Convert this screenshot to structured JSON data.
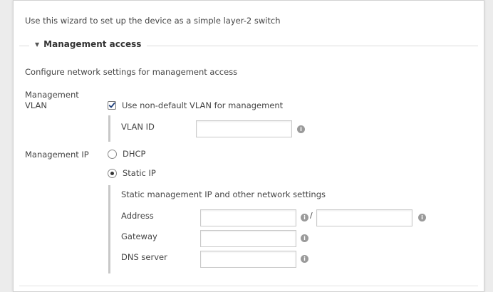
{
  "intro_text": "Use this wizard to set up the device as a simple layer-2 switch",
  "section": {
    "title": "Management access",
    "description": "Configure network settings for management access"
  },
  "vlan": {
    "label_line1": "Management",
    "label_line2": "VLAN",
    "checkbox_label": "Use non-default VLAN for management",
    "checked": true,
    "vlan_id_label": "VLAN ID",
    "vlan_id_value": ""
  },
  "ip": {
    "label": "Management IP",
    "options": [
      "DHCP",
      "Static IP"
    ],
    "selected": "Static IP",
    "static_heading": "Static management IP and other network settings",
    "address_label": "Address",
    "address_value": "",
    "prefix_value": "",
    "slash": "/",
    "gateway_label": "Gateway",
    "gateway_value": "",
    "dns_label": "DNS server",
    "dns_value": ""
  },
  "info_glyph": "i",
  "icons": {
    "caret": "caret-down-icon",
    "checkbox": "checkmark-icon",
    "info": "info-icon"
  }
}
